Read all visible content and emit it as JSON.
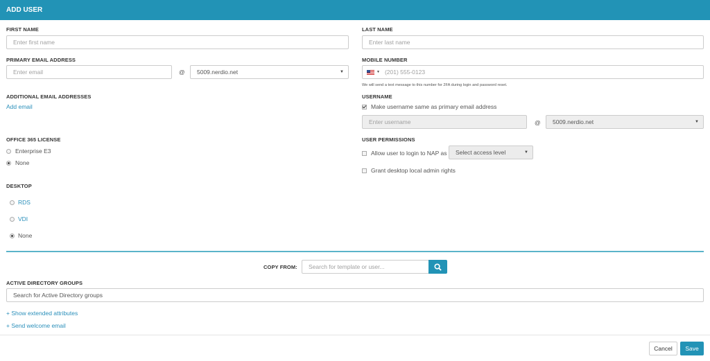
{
  "header": {
    "title": "ADD USER"
  },
  "first_name": {
    "label": "FIRST NAME",
    "placeholder": "Enter first name"
  },
  "last_name": {
    "label": "LAST NAME",
    "placeholder": "Enter last name"
  },
  "primary_email": {
    "label": "PRIMARY EMAIL ADDRESS",
    "placeholder": "Enter email",
    "at": "@",
    "domain": "5009.nerdio.net"
  },
  "mobile": {
    "label": "MOBILE NUMBER",
    "placeholder": "(201) 555-0123",
    "hint": "We will send a text message to this number for 2FA during login and password reset."
  },
  "additional_email": {
    "label": "ADDITIONAL EMAIL ADDRESSES",
    "add_link": "Add email"
  },
  "username": {
    "label": "USERNAME",
    "same_as_email": "Make username same as primary email address",
    "placeholder": "Enter username",
    "at": "@",
    "domain": "5009.nerdio.net"
  },
  "office365": {
    "label": "OFFICE 365 LICENSE",
    "options": [
      "Enterprise E3",
      "None"
    ],
    "selected": "None"
  },
  "permissions": {
    "label": "USER PERMISSIONS",
    "allow_login": "Allow user to login to NAP as",
    "access_level": "Select access level",
    "admin_rights": "Grant desktop local admin rights"
  },
  "desktop": {
    "label": "DESKTOP",
    "options": [
      "RDS",
      "VDI",
      "None"
    ],
    "selected": "None"
  },
  "copy_from": {
    "label": "COPY FROM:",
    "placeholder": "Search for template or user..."
  },
  "ad_groups": {
    "label": "ACTIVE DIRECTORY GROUPS",
    "placeholder": "Search for Active Directory groups"
  },
  "links": {
    "extended": "+ Show extended attributes",
    "welcome": "+ Send welcome email"
  },
  "footer": {
    "cancel": "Cancel",
    "save": "Save"
  },
  "colors": {
    "brand": "#2293b6",
    "divider": "#5ab4c9",
    "link": "#2a8fba"
  }
}
